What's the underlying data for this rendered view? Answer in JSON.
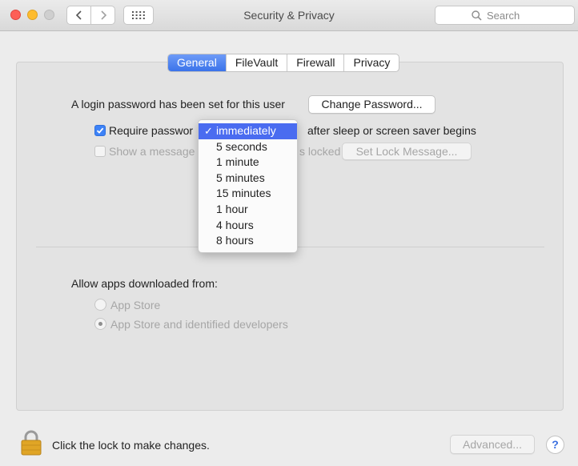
{
  "window": {
    "title": "Security & Privacy",
    "search_placeholder": "Search"
  },
  "tabs": [
    {
      "label": "General",
      "active": true
    },
    {
      "label": "FileVault",
      "active": false
    },
    {
      "label": "Firewall",
      "active": false
    },
    {
      "label": "Privacy",
      "active": false
    }
  ],
  "general": {
    "login_text": "A login password has been set for this user",
    "change_password_label": "Change Password...",
    "require_password_label": "Require passwor",
    "require_password_checked": true,
    "after_sleep_label": "after sleep or screen saver begins",
    "show_message_label": "Show a message",
    "locked_label": "s locked",
    "set_lock_message_label": "Set Lock Message...",
    "allow_apps_label": "Allow apps downloaded from:",
    "app_store_label": "App Store",
    "identified_devs_label": "App Store and identified developers",
    "selected_source": "App Store and identified developers"
  },
  "require_menu": {
    "selected": "immediately",
    "check_glyph": "✓",
    "options": [
      "immediately",
      "5 seconds",
      "1 minute",
      "5 minutes",
      "15 minutes",
      "1 hour",
      "4 hours",
      "8 hours"
    ]
  },
  "footer": {
    "lock_text": "Click the lock to make changes.",
    "advanced_label": "Advanced...",
    "help_label": "?"
  },
  "colors": {
    "accent": "#3b73ea",
    "menu_highlight": "#4a6cf0",
    "close": "#fd5f57",
    "minimize": "#febc2e",
    "lock": "#e0a526"
  }
}
